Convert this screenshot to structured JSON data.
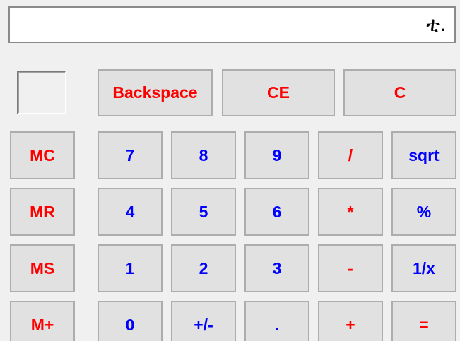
{
  "display": {
    "value": "ቲ."
  },
  "top_row": {
    "backspace": "Backspace",
    "ce": "CE",
    "c": "C"
  },
  "memory": {
    "mc": "MC",
    "mr": "MR",
    "ms": "MS",
    "mplus": "M+"
  },
  "keys": {
    "k7": "7",
    "k8": "8",
    "k9": "9",
    "k4": "4",
    "k5": "5",
    "k6": "6",
    "k1": "1",
    "k2": "2",
    "k3": "3",
    "k0": "0",
    "sign": "+/-",
    "dot": "."
  },
  "ops": {
    "divide": "/",
    "multiply": "*",
    "minus": "-",
    "plus": "+",
    "sqrt": "sqrt",
    "percent": "%",
    "reciprocal": "1/x",
    "equals": "="
  },
  "colors": {
    "red_text": "#ff0000",
    "blue_text": "#0000ff",
    "button_face": "#e1e1e1",
    "background": "#f0f0f0"
  }
}
